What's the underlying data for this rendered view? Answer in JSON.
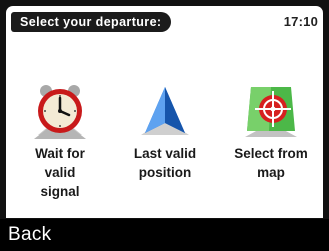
{
  "header": {
    "title": "Select your departure:",
    "clock": "17:10"
  },
  "options": [
    {
      "label_lines": [
        "Wait for",
        "valid",
        "signal"
      ],
      "icon": "alarm-clock-icon"
    },
    {
      "label_lines": [
        "Last valid",
        "position"
      ],
      "icon": "navigation-arrow-icon"
    },
    {
      "label_lines": [
        "Select from",
        "map"
      ],
      "icon": "map-target-icon"
    }
  ],
  "footer": {
    "back_label": "Back"
  },
  "colors": {
    "screen_bg": "#ffffff",
    "bezel": "#111111",
    "clock_red": "#c8191a",
    "arrow_blue": "#1f6fd6",
    "map_green": "#4cb848",
    "target_red": "#d6201f"
  }
}
